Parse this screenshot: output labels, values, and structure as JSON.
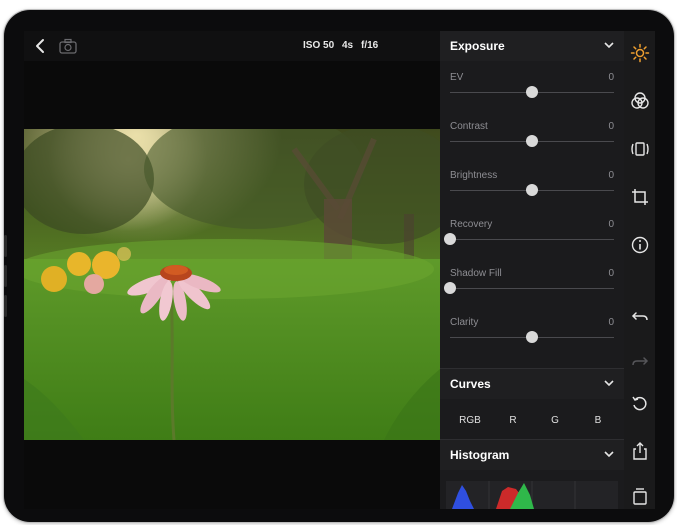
{
  "toolbar": {
    "iso": "ISO 50",
    "shutter": "4s",
    "aperture": "f/16"
  },
  "panel": {
    "exposure_title": "Exposure",
    "sliders": [
      {
        "label": "EV",
        "value": "0",
        "level": 0.5
      },
      {
        "label": "Contrast",
        "value": "0",
        "level": 0.5
      },
      {
        "label": "Brightness",
        "value": "0",
        "level": 0.5
      },
      {
        "label": "Recovery",
        "value": "0",
        "level": 0
      },
      {
        "label": "Shadow Fill",
        "value": "0",
        "level": 0
      },
      {
        "label": "Clarity",
        "value": "0",
        "level": 0.5
      }
    ],
    "curves_title": "Curves",
    "curve_channels": [
      "RGB",
      "R",
      "G",
      "B"
    ],
    "histogram_title": "Histogram"
  },
  "icons": {
    "active_tool_color": "#f0a030",
    "tool_color": "#e6e6e6"
  }
}
